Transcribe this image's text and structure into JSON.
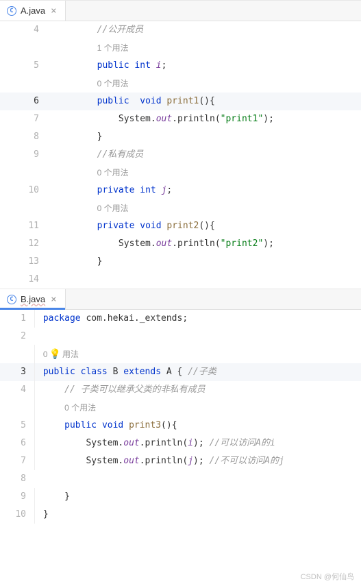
{
  "tabs": [
    {
      "label": "A.java",
      "icon_letter": "C"
    },
    {
      "label": "B.java",
      "icon_letter": "C"
    }
  ],
  "editorA": {
    "lines": {
      "4": {
        "comment": "//公开成员"
      },
      "4_hint": "1 个用法",
      "5": {
        "kw1": "public",
        "type": "int",
        "name": "i",
        "sc": ";"
      },
      "5_hint": "0 个用法",
      "6": {
        "kw1": "public",
        "kw2": "void",
        "name": "print1",
        "paren": "(){"
      },
      "7": {
        "obj": "System.",
        "out": "out",
        "call": ".println(",
        "str": "\"print1\"",
        "end": ");"
      },
      "8": {
        "brace": "}"
      },
      "9": {
        "comment": "//私有成员"
      },
      "9_hint": "0 个用法",
      "10": {
        "kw1": "private",
        "type": "int",
        "name": "j",
        "sc": ";"
      },
      "10_hint": "0 个用法",
      "11": {
        "kw1": "private",
        "kw2": "void",
        "name": "print2",
        "paren": "(){"
      },
      "12": {
        "obj": "System.",
        "out": "out",
        "call": ".println(",
        "str": "\"print2\"",
        "end": ");"
      },
      "13": {
        "brace": "}"
      }
    }
  },
  "editorB": {
    "lines": {
      "1": {
        "kw": "package",
        "pkg": "com.hekai._extends;"
      },
      "2_hint_pre": "0",
      "2_hint_post": "用法",
      "3": {
        "kw1": "public",
        "kw2": "class",
        "name": "B",
        "kw3": "extends",
        "super": "A",
        "brace": "{",
        "comment": "//子类"
      },
      "4": {
        "comment": "// 子类可以继承父类的非私有成员"
      },
      "4_hint": "0 个用法",
      "5": {
        "kw1": "public",
        "kw2": "void",
        "name": "print3",
        "paren": "(){"
      },
      "6": {
        "obj": "System.",
        "out": "out",
        "call": ".println(",
        "arg": "i",
        "end": ");",
        "comment": "//可以访问A的i"
      },
      "7": {
        "obj": "System.",
        "out": "out",
        "call": ".println(",
        "arg": "j",
        "end": ");",
        "comment": "//不可以访问A的j"
      },
      "9": {
        "brace": "}"
      },
      "10": {
        "brace": "}"
      }
    }
  },
  "watermark": "CSDN @何仙鸟"
}
